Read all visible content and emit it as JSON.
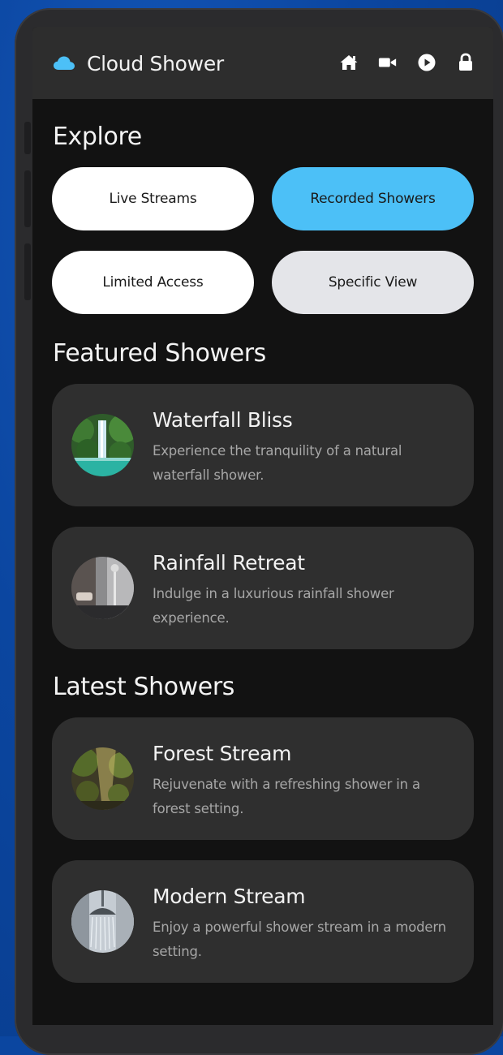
{
  "app": {
    "title": "Cloud Shower",
    "logo_icon": "cloud-icon",
    "accent": "#4cc0f7"
  },
  "nav": [
    {
      "icon": "home-icon"
    },
    {
      "icon": "video-camera-icon"
    },
    {
      "icon": "play-circle-icon"
    },
    {
      "icon": "lock-icon"
    }
  ],
  "explore": {
    "title": "Explore",
    "buttons": [
      {
        "label": "Live Streams",
        "style": "white"
      },
      {
        "label": "Recorded Showers",
        "style": "blue",
        "selected": true
      },
      {
        "label": "Limited Access",
        "style": "white"
      },
      {
        "label": "Specific View",
        "style": "grey"
      }
    ]
  },
  "featured": {
    "title": "Featured Showers",
    "items": [
      {
        "title": "Waterfall Bliss",
        "description": "Experience the tranquility of a natural waterfall shower."
      },
      {
        "title": "Rainfall Retreat",
        "description": "Indulge in a luxurious rainfall shower experience."
      }
    ]
  },
  "latest": {
    "title": "Latest Showers",
    "items": [
      {
        "title": "Forest Stream",
        "description": "Rejuvenate with a refreshing shower in a forest setting."
      },
      {
        "title": "Modern Stream",
        "description": "Enjoy a powerful shower stream in a modern setting."
      }
    ]
  }
}
